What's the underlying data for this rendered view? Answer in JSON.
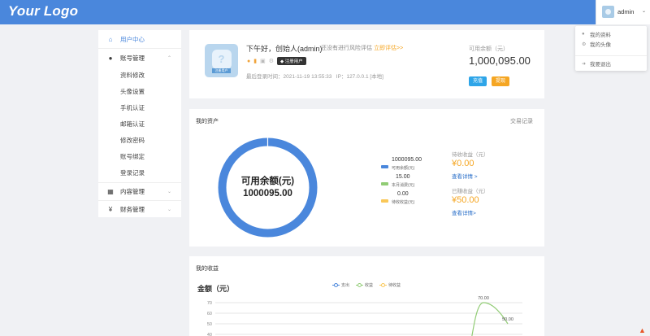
{
  "header": {
    "logo": "Your Logo",
    "user": "admin",
    "caret": "⌄"
  },
  "dropdown": {
    "items": [
      "我的资料",
      "我的头像",
      "我要退出"
    ]
  },
  "sidebar": {
    "items": [
      {
        "label": "用户中心",
        "icon": "home-icon",
        "active": true
      },
      {
        "label": "账号管理",
        "icon": "user-icon"
      },
      {
        "label": "内容管理",
        "icon": "grid-icon"
      },
      {
        "label": "财务管理",
        "icon": "yen-icon"
      }
    ],
    "sub_items": [
      "资料修改",
      "头像设置",
      "手机认证",
      "邮箱认证",
      "修改密码",
      "账号绑定",
      "登录记录"
    ]
  },
  "profile": {
    "greeting": "下午好，创始人(admin)",
    "risk_text": "还没有进行风险评估",
    "assess_link": "立即评估>>",
    "vip_badge": "注册用户",
    "last_login_label": "最后登录时间：",
    "last_login": "2021-11-19 13:55:33",
    "ip_label": "IP：",
    "ip": "127.0.0.1 [本地]",
    "avatar_tag": "注册用户",
    "balance_label": "可用余额（元）",
    "balance": "1,000,095.00",
    "recharge": "充值",
    "withdraw": "提现"
  },
  "assets": {
    "title": "我的资产",
    "link": "交易记录",
    "donut_center_label": "可用余额(元)",
    "donut_center_value": "1000095.00",
    "legend": [
      {
        "value": "1000095.00",
        "label": "可用余额(元)",
        "color": "#4a87dc"
      },
      {
        "value": "15.00",
        "label": "本月消费(元)",
        "color": "#91cc75"
      },
      {
        "value": "0.00",
        "label": "待收收益(元)",
        "color": "#fac858"
      }
    ],
    "pending_label": "待收收益（元）",
    "pending_value": "¥0.00",
    "pending_link": "查看详情 >",
    "earned_label": "已赚收益（元）",
    "earned_value": "¥50.00",
    "earned_link": "查看详情>"
  },
  "income": {
    "title": "我的收益",
    "heading": "金额（元）",
    "legend": [
      {
        "name": "支出",
        "color": "#4a87dc"
      },
      {
        "name": "收益",
        "color": "#91cc75"
      },
      {
        "name": "待收益",
        "color": "#fac858"
      }
    ]
  },
  "chart_data": {
    "type": "line",
    "title": "",
    "ylabel": "金额（元）",
    "y_ticks": [
      40,
      50,
      60,
      70
    ],
    "ylim": [
      40,
      70
    ],
    "series": [
      {
        "name": "收益",
        "points": [
          {
            "label": "70.00",
            "y": 70
          },
          {
            "label": "50.00",
            "y": 50
          }
        ]
      }
    ]
  }
}
